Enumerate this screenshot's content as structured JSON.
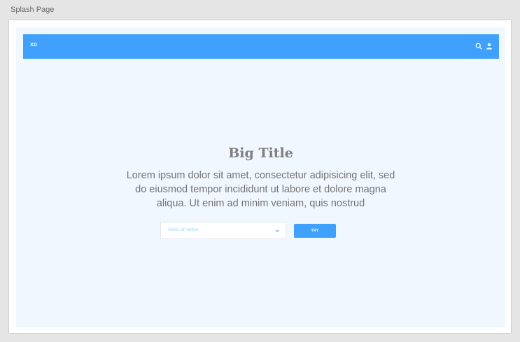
{
  "artboard": {
    "label": "Splash Page"
  },
  "navbar": {
    "brand": "XD",
    "icons": [
      "search-icon",
      "user-icon"
    ],
    "background": "#3fa1fb"
  },
  "hero": {
    "title": "Big Title",
    "body": "Lorem ipsum dolor sit amet, consectetur adipisicing elit, sed do eiusmod tempor incididunt ut labore et dolore magna aliqua. Ut enim ad minim veniam, quis nostrud"
  },
  "form": {
    "select_placeholder": "Select an option",
    "try_label": "TRY"
  },
  "colors": {
    "accent": "#3fa1fb",
    "page_background": "#f0f7fe",
    "title_text": "#7f7f7f",
    "body_text": "#737373"
  }
}
